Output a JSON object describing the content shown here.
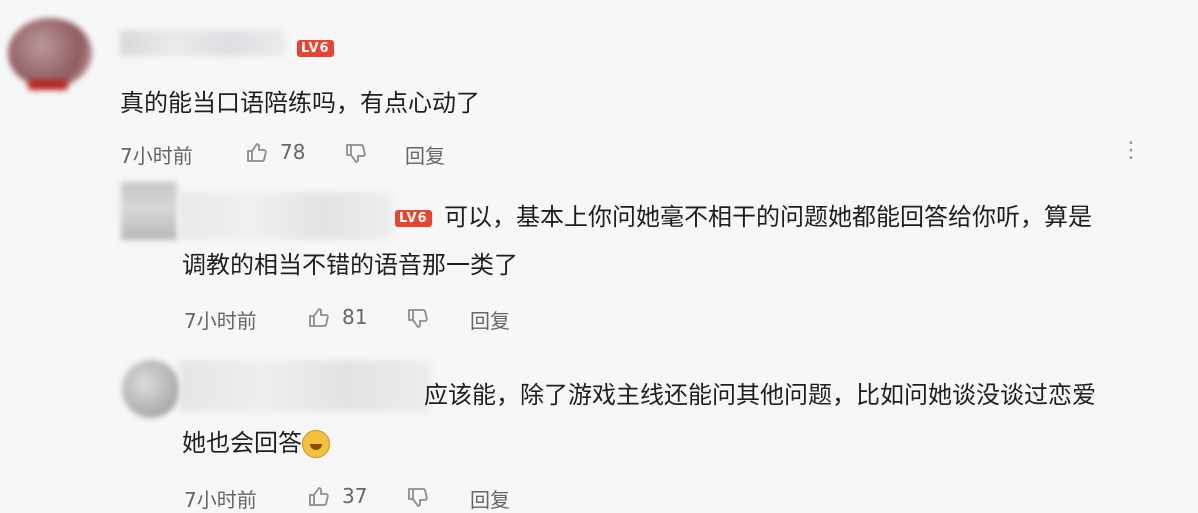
{
  "comments": [
    {
      "level": "LV6",
      "text": "真的能当口语陪练吗，有点心动了",
      "time": "7小时前",
      "likes": "78",
      "reply_label": "回复",
      "more_label": "⋮"
    },
    {
      "level": "LV6",
      "text_line1": "可以，基本上你问她毫不相干的问题她都能回答给你听，算是",
      "text_line2": "调教的相当不错的语音那一类了",
      "time": "7小时前",
      "likes": "81",
      "reply_label": "回复"
    },
    {
      "text_line1": "应该能，除了游戏主线还能问其他问题，比如问她谈没谈过恋爱",
      "text_line2": "她也会回答",
      "emoji": "laughing-face",
      "time": "7小时前",
      "likes": "37",
      "reply_label": "回复"
    }
  ],
  "colors": {
    "level_badge": "#e8442f",
    "meta_text": "#666666",
    "body_text": "#1f1f1f"
  },
  "icons": [
    "thumbs-up-icon",
    "thumbs-down-icon",
    "more-icon"
  ]
}
